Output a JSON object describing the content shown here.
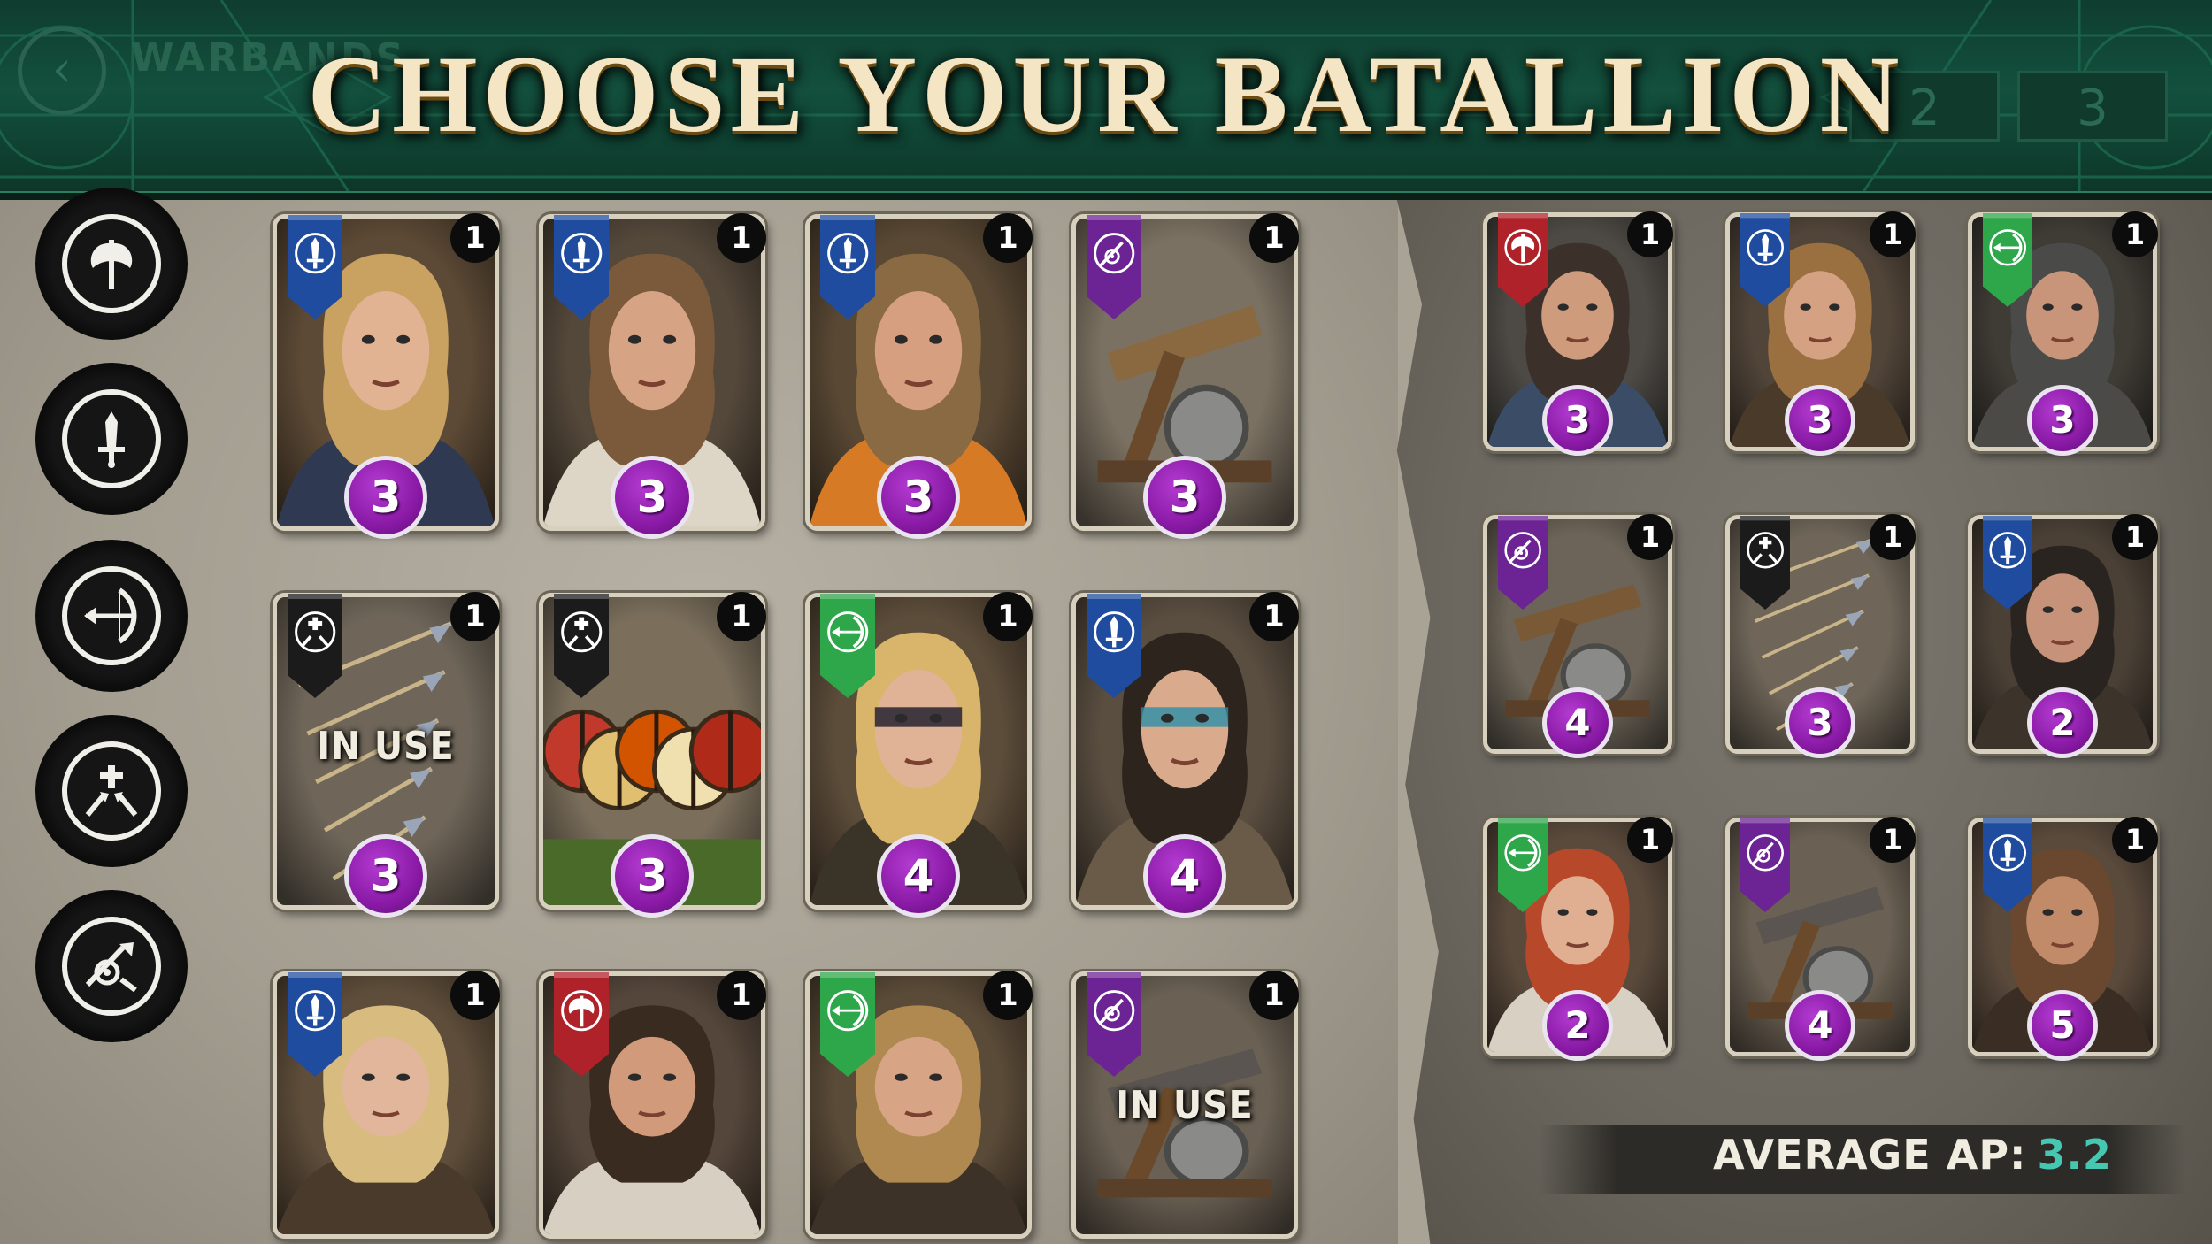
{
  "header": {
    "title": "CHOOSE YOUR BATALLION",
    "nav_label": "WARBANDS",
    "tabs": [
      "2",
      "3"
    ]
  },
  "filters": [
    {
      "name": "axe",
      "icon": "axe-icon"
    },
    {
      "name": "sword",
      "icon": "sword-icon"
    },
    {
      "name": "bow",
      "icon": "bow-icon"
    },
    {
      "name": "arrows",
      "icon": "arrows-icon"
    },
    {
      "name": "siege",
      "icon": "siege-icon"
    }
  ],
  "colors": {
    "blue": "#1f4c9e",
    "purple": "#6c2394",
    "black": "#1b1b1b",
    "green": "#2ea64a",
    "red": "#b0222a",
    "cost": "#8a1aa6",
    "ap_value": "#45c7b2"
  },
  "collection": [
    {
      "id": "c1",
      "banner": "blue",
      "banner_icon": "sword-icon",
      "count": "1",
      "cost": "3",
      "in_use": "",
      "art": "shieldmaiden-blonde"
    },
    {
      "id": "c2",
      "banner": "blue",
      "banner_icon": "sword-icon",
      "count": "1",
      "cost": "3",
      "in_use": "",
      "art": "warrior-longhair"
    },
    {
      "id": "c3",
      "banner": "blue",
      "banner_icon": "sword-icon",
      "count": "1",
      "cost": "3",
      "in_use": "",
      "art": "warrior-orange-cloak"
    },
    {
      "id": "c4",
      "banner": "purple",
      "banner_icon": "siege-icon",
      "count": "1",
      "cost": "3",
      "in_use": "",
      "art": "ballista"
    },
    {
      "id": "c5",
      "banner": "black",
      "banner_icon": "arrows-icon",
      "count": "1",
      "cost": "3",
      "in_use": "IN USE",
      "art": "arrow-volley"
    },
    {
      "id": "c6",
      "banner": "black",
      "banner_icon": "arrows-icon",
      "count": "1",
      "cost": "3",
      "in_use": "",
      "art": "shield-wall"
    },
    {
      "id": "c7",
      "banner": "green",
      "banner_icon": "bow-icon",
      "count": "1",
      "cost": "4",
      "in_use": "",
      "art": "archer-braids"
    },
    {
      "id": "c8",
      "banner": "blue",
      "banner_icon": "sword-icon",
      "count": "1",
      "cost": "4",
      "in_use": "",
      "art": "warrior-warpaint"
    },
    {
      "id": "c9",
      "banner": "blue",
      "banner_icon": "sword-icon",
      "count": "1",
      "cost": "",
      "in_use": "",
      "art": "shieldmaiden-braid"
    },
    {
      "id": "c10",
      "banner": "red",
      "banner_icon": "axe-icon",
      "count": "1",
      "cost": "",
      "in_use": "",
      "art": "warrior-beard"
    },
    {
      "id": "c11",
      "banner": "green",
      "banner_icon": "bow-icon",
      "count": "1",
      "cost": "",
      "in_use": "",
      "art": "archer-blond"
    },
    {
      "id": "c12",
      "banner": "purple",
      "banner_icon": "siege-icon",
      "count": "1",
      "cost": "",
      "in_use": "IN USE",
      "art": "ram"
    }
  ],
  "deck": [
    {
      "id": "d1",
      "banner": "red",
      "banner_icon": "axe-icon",
      "count": "1",
      "cost": "3",
      "art": "warrior-grim"
    },
    {
      "id": "d2",
      "banner": "blue",
      "banner_icon": "sword-icon",
      "count": "1",
      "cost": "3",
      "art": "warrior-fist"
    },
    {
      "id": "d3",
      "banner": "green",
      "banner_icon": "bow-icon",
      "count": "1",
      "cost": "3",
      "art": "archer-hood"
    },
    {
      "id": "d4",
      "banner": "purple",
      "banner_icon": "siege-icon",
      "count": "1",
      "cost": "4",
      "art": "catapult"
    },
    {
      "id": "d5",
      "banner": "black",
      "banner_icon": "arrows-icon",
      "count": "1",
      "cost": "3",
      "art": "arrow-volley"
    },
    {
      "id": "d6",
      "banner": "blue",
      "banner_icon": "sword-icon",
      "count": "1",
      "cost": "2",
      "art": "warrior-dark"
    },
    {
      "id": "d7",
      "banner": "green",
      "banner_icon": "bow-icon",
      "count": "1",
      "cost": "2",
      "art": "archer-redhead"
    },
    {
      "id": "d8",
      "banner": "purple",
      "banner_icon": "siege-icon",
      "count": "1",
      "cost": "4",
      "art": "ram"
    },
    {
      "id": "d9",
      "banner": "blue",
      "banner_icon": "sword-icon",
      "count": "1",
      "cost": "5",
      "art": "shieldmaiden-curly"
    }
  ],
  "average_ap": {
    "label": "AVERAGE AP:",
    "value": "3.2"
  }
}
